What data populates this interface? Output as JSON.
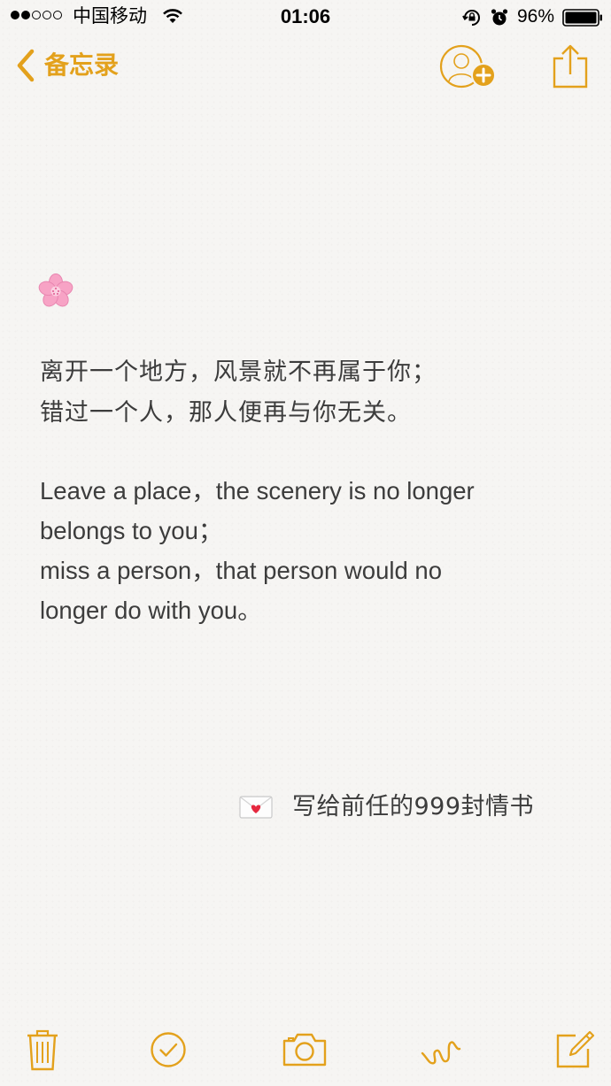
{
  "status_bar": {
    "carrier": "中国移动",
    "time": "01:06",
    "battery_percent": "96%"
  },
  "nav": {
    "back_label": "备忘录",
    "accent_color": "#e3a11c"
  },
  "note": {
    "emoji": "cherry-blossom-icon",
    "chinese_lines": [
      "离开一个地方，风景就不再属于你；",
      "错过一个人，那人便再与你无关。"
    ],
    "english_lines": [
      "Leave a place，the scenery is no longer",
      "belongs to you；",
      "miss a person，that person would no",
      "longer do with you。"
    ],
    "signature": "写给前任的999封情书"
  },
  "toolbar": {
    "items": [
      "trash-icon",
      "checklist-icon",
      "camera-icon",
      "sketch-icon",
      "compose-icon"
    ]
  }
}
